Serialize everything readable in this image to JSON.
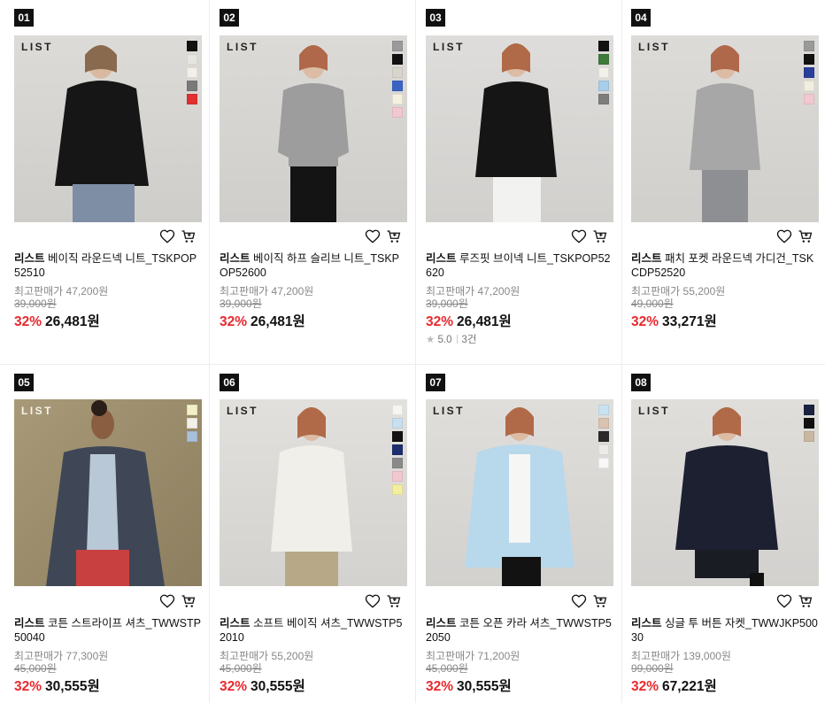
{
  "products": [
    {
      "rank": "01",
      "brand": "리스트",
      "name": "베이직 라운드넥 니트_TSKPOP52510",
      "max_price": "최고판매가 47,200원",
      "original": "39,000원",
      "discount": "32%",
      "price": "26,481원",
      "image_logo": "LIST",
      "swatches": [
        "#111111",
        "#e6e6e0",
        "#f2f0e8",
        "#7a7a7a",
        "#e03030"
      ]
    },
    {
      "rank": "02",
      "brand": "리스트",
      "name": "베이직 하프 슬리브 니트_TSKPOP52600",
      "max_price": "최고판매가 47,200원",
      "original": "39,000원",
      "discount": "32%",
      "price": "26,481원",
      "image_logo": "LIST",
      "swatches": [
        "#9a9a9a",
        "#111111",
        "#d8d6cc",
        "#3b63c4",
        "#f5f0e0",
        "#f2c8d0"
      ]
    },
    {
      "rank": "03",
      "brand": "리스트",
      "name": "루즈핏 브이넥 니트_TSKPOP52620",
      "max_price": "최고판매가 47,200원",
      "original": "39,000원",
      "discount": "32%",
      "price": "26,481원",
      "image_logo": "LIST",
      "swatches": [
        "#111111",
        "#3e7a3a",
        "#f2f0e8",
        "#a8cde8",
        "#7d7d7d"
      ],
      "rating": "5.0",
      "reviews": "3건"
    },
    {
      "rank": "04",
      "brand": "리스트",
      "name": "패치 포켓 라운드넥 가디건_TSKCDP52520",
      "max_price": "최고판매가 55,200원",
      "original": "49,000원",
      "discount": "32%",
      "price": "33,271원",
      "image_logo": "LIST",
      "swatches": [
        "#9a9a9a",
        "#111111",
        "#2a3f9a",
        "#f3efe0",
        "#f2c8d0"
      ]
    },
    {
      "rank": "05",
      "brand": "리스트",
      "name": "코튼 스트라이프 셔츠_TWWSTP50040",
      "max_price": "최고판매가 77,300원",
      "original": "45,000원",
      "discount": "32%",
      "price": "30,555원",
      "image_logo": "LIST",
      "swatches": [
        "#f3f0c8",
        "#f2f0e8",
        "#a8c0dc"
      ]
    },
    {
      "rank": "06",
      "brand": "리스트",
      "name": "소프트 베이직 셔츠_TWWSTP52010",
      "max_price": "최고판매가 55,200원",
      "original": "45,000원",
      "discount": "32%",
      "price": "30,555원",
      "image_logo": "LIST",
      "swatches": [
        "#f5f5f2",
        "#c8dff0",
        "#111111",
        "#1d2d6e",
        "#8a8a8a",
        "#f2c8d0",
        "#f3eea0"
      ]
    },
    {
      "rank": "07",
      "brand": "리스트",
      "name": "코튼 오픈 카라 셔츠_TWWSTP52050",
      "max_price": "최고판매가 71,200원",
      "original": "45,000원",
      "discount": "32%",
      "price": "30,555원",
      "image_logo": "LIST",
      "swatches": [
        "#c8e2f0",
        "#d9c3b0",
        "#2a2a2a",
        "#ecebe5",
        "#f7f7f7"
      ]
    },
    {
      "rank": "08",
      "brand": "리스트",
      "name": "싱글 투 버튼 자켓_TWWJKP50030",
      "max_price": "최고판매가 139,000원",
      "original": "99,000원",
      "discount": "32%",
      "price": "67,221원",
      "image_logo": "LIST",
      "swatches": [
        "#1a2240",
        "#111111",
        "#c8b8a0"
      ]
    }
  ]
}
